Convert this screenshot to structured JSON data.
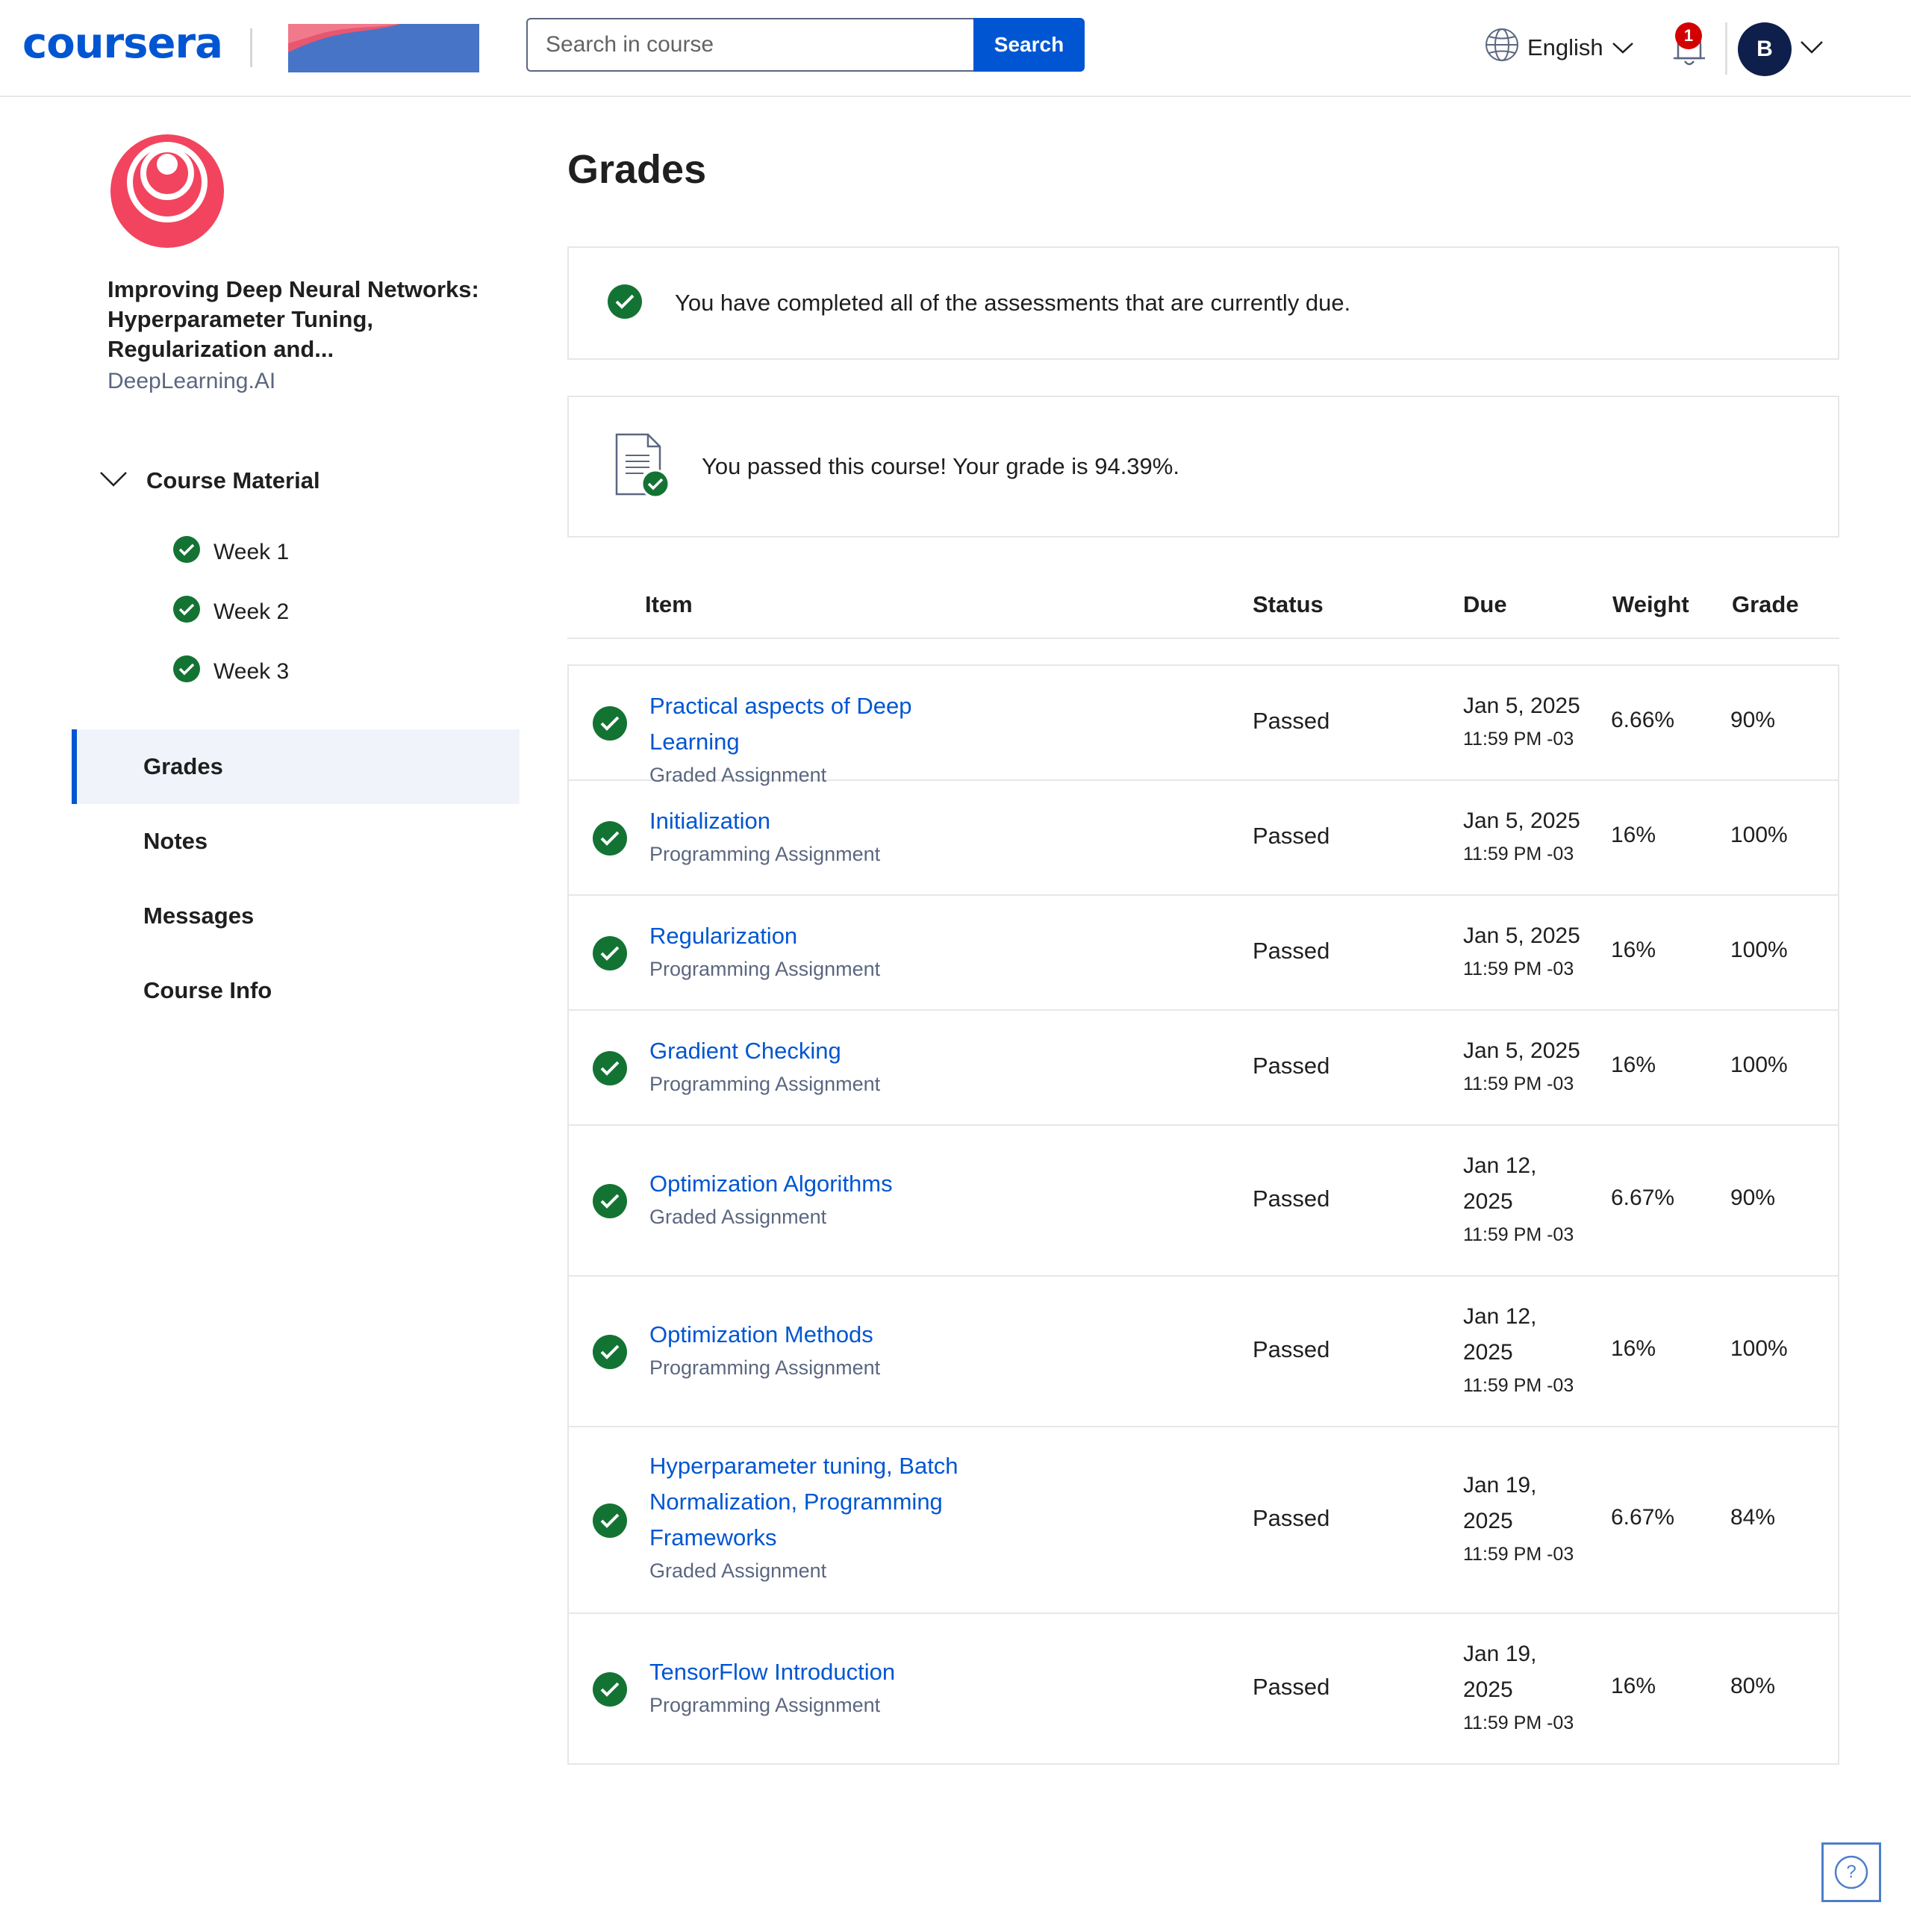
{
  "header": {
    "logo_text": "coursera",
    "search_placeholder": "Search in course",
    "search_button": "Search",
    "language": "English",
    "notification_count": "1",
    "avatar_initial": "B"
  },
  "sidebar": {
    "course_title": "Improving Deep Neural Networks: Hyperparameter Tuning, Regularization and...",
    "course_partner": "DeepLearning.AI",
    "course_material_label": "Course Material",
    "weeks": [
      "Week 1",
      "Week 2",
      "Week 3"
    ],
    "nav": [
      "Grades",
      "Notes",
      "Messages",
      "Course Info"
    ],
    "active_nav": "Grades"
  },
  "main": {
    "title": "Grades",
    "completed_message": "You have completed all of the assessments that are currently due.",
    "passed_message": "You passed this course! Your grade is 94.39%.",
    "columns": {
      "item": "Item",
      "status": "Status",
      "due": "Due",
      "weight": "Weight",
      "grade": "Grade"
    },
    "rows": [
      {
        "name": "Practical aspects of Deep Learning",
        "type": "Graded Assignment",
        "status": "Passed",
        "due_date": "Jan 5, 2025",
        "due_time": "11:59 PM -03",
        "weight": "6.66%",
        "grade": "90%"
      },
      {
        "name": "Initialization",
        "type": "Programming Assignment",
        "status": "Passed",
        "due_date": "Jan 5, 2025",
        "due_time": "11:59 PM -03",
        "weight": "16%",
        "grade": "100%"
      },
      {
        "name": "Regularization",
        "type": "Programming Assignment",
        "status": "Passed",
        "due_date": "Jan 5, 2025",
        "due_time": "11:59 PM -03",
        "weight": "16%",
        "grade": "100%"
      },
      {
        "name": "Gradient Checking",
        "type": "Programming Assignment",
        "status": "Passed",
        "due_date": "Jan 5, 2025",
        "due_time": "11:59 PM -03",
        "weight": "16%",
        "grade": "100%"
      },
      {
        "name": "Optimization Algorithms",
        "type": "Graded Assignment",
        "status": "Passed",
        "due_date": "Jan 12, 2025",
        "due_time": "11:59 PM -03",
        "weight": "6.67%",
        "grade": "90%"
      },
      {
        "name": "Optimization Methods",
        "type": "Programming Assignment",
        "status": "Passed",
        "due_date": "Jan 12, 2025",
        "due_time": "11:59 PM -03",
        "weight": "16%",
        "grade": "100%"
      },
      {
        "name": "Hyperparameter tuning, Batch Normalization, Programming Frameworks",
        "type": "Graded Assignment",
        "status": "Passed",
        "due_date": "Jan 19, 2025",
        "due_time": "11:59 PM -03",
        "weight": "6.67%",
        "grade": "84%"
      },
      {
        "name": "TensorFlow Introduction",
        "type": "Programming Assignment",
        "status": "Passed",
        "due_date": "Jan 19, 2025",
        "due_time": "11:59 PM -03",
        "weight": "16%",
        "grade": "80%"
      }
    ]
  },
  "help": {
    "icon_glyph": "?"
  },
  "colors": {
    "brand_blue": "#0056d2",
    "success_green": "#137333",
    "badge_red": "#d30001",
    "logo_pink": "#f2445e",
    "active_nav_bg": "#f0f4fa",
    "border_gray": "#e5e7e8"
  },
  "icons": {
    "check": "check-circle-icon",
    "globe": "globe-icon",
    "bell": "bell-icon",
    "chevron": "chevron-down-icon",
    "document": "document-check-icon",
    "help": "help-icon"
  }
}
